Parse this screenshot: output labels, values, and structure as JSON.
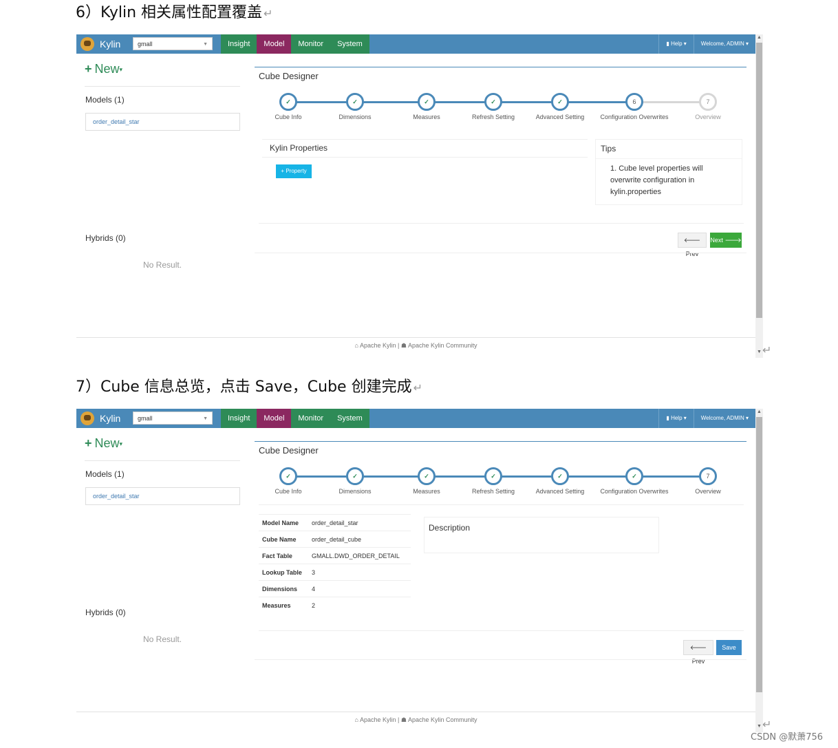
{
  "sections": [
    {
      "heading": "6）Kylin 相关属性配置覆盖",
      "ui": {
        "brand": "Kylin",
        "project": "gmall",
        "tabs": [
          "Insight",
          "Model",
          "Monitor",
          "System"
        ],
        "active_tab": "Model",
        "help": "Help",
        "welcome": "Welcome, ADMIN",
        "new_label": "New",
        "models_label": "Models (1)",
        "model_item": "order_detail_star",
        "hybrids_label": "Hybrids (0)",
        "no_result": "No Result.",
        "designer_title": "Cube Designer",
        "steps": [
          {
            "label": "Cube Info",
            "status": "done"
          },
          {
            "label": "Dimensions",
            "status": "done"
          },
          {
            "label": "Measures",
            "status": "done"
          },
          {
            "label": "Refresh Setting",
            "status": "done"
          },
          {
            "label": "Advanced Setting",
            "status": "done"
          },
          {
            "label": "Configuration Overwrites",
            "status": "current",
            "number": "6"
          },
          {
            "label": "Overview",
            "status": "pending",
            "number": "7"
          }
        ],
        "kylin_properties_title": "Kylin Properties",
        "add_property_label": "Property",
        "tips_title": "Tips",
        "tips_text": "1. Cube level properties will overwrite configuration in kylin.properties",
        "prev_label": "Prev",
        "next_label": "Next",
        "footer_left": "Apache Kylin",
        "footer_sep": "|",
        "footer_right": "Apache Kylin Community"
      }
    },
    {
      "heading": "7）Cube 信息总览，点击 Save，Cube 创建完成",
      "ui": {
        "brand": "Kylin",
        "project": "gmall",
        "tabs": [
          "Insight",
          "Model",
          "Monitor",
          "System"
        ],
        "active_tab": "Model",
        "help": "Help",
        "welcome": "Welcome, ADMIN",
        "new_label": "New",
        "models_label": "Models (1)",
        "model_item": "order_detail_star",
        "hybrids_label": "Hybrids (0)",
        "no_result": "No Result.",
        "designer_title": "Cube Designer",
        "steps": [
          {
            "label": "Cube Info",
            "status": "done"
          },
          {
            "label": "Dimensions",
            "status": "done"
          },
          {
            "label": "Measures",
            "status": "done"
          },
          {
            "label": "Refresh Setting",
            "status": "done"
          },
          {
            "label": "Advanced Setting",
            "status": "done"
          },
          {
            "label": "Configuration Overwrites",
            "status": "done"
          },
          {
            "label": "Overview",
            "status": "current",
            "number": "7"
          }
        ],
        "overview": [
          {
            "key": "Model Name",
            "value": "order_detail_star"
          },
          {
            "key": "Cube Name",
            "value": "order_detail_cube"
          },
          {
            "key": "Fact Table",
            "value": "GMALL.DWD_ORDER_DETAIL"
          },
          {
            "key": "Lookup Table",
            "value": "3"
          },
          {
            "key": "Dimensions",
            "value": "4"
          },
          {
            "key": "Measures",
            "value": "2"
          }
        ],
        "description_title": "Description",
        "prev_label": "Prev",
        "save_label": "Save",
        "footer_left": "Apache Kylin",
        "footer_sep": "|",
        "footer_right": "Apache Kylin Community"
      }
    }
  ],
  "watermark": "CSDN @默萧756",
  "colors": {
    "navbar": "#4a89b8",
    "tabs_bg": "#2e8b57",
    "active_tab": "#8b2860",
    "step_ring": "#4a89b8",
    "check": "#2e8b57",
    "next_button": "#3ba83b",
    "save_button": "#3d8cc8",
    "property_button": "#17b4e6"
  }
}
